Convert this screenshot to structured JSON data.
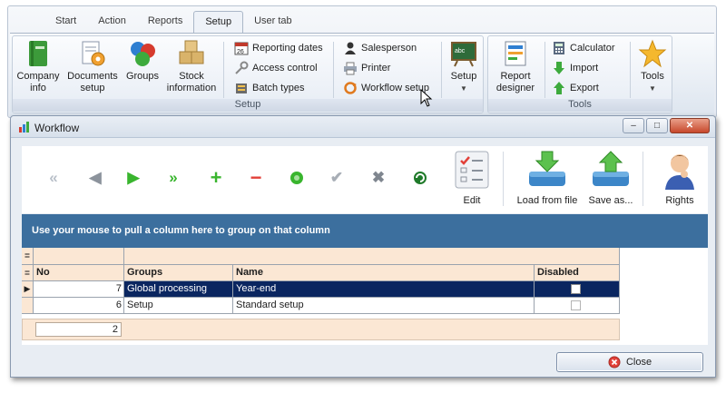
{
  "ribbon": {
    "tabs": [
      "Start",
      "Action",
      "Reports",
      "Setup",
      "User tab"
    ],
    "active_tab": "Setup",
    "setup_group": {
      "label": "Setup",
      "company_info": "Company info",
      "documents_setup": "Documents setup",
      "groups": "Groups",
      "stock_information": "Stock information",
      "reporting_dates": "Reporting dates",
      "access_control": "Access control",
      "batch_types": "Batch types",
      "salesperson": "Salesperson",
      "printer": "Printer",
      "workflow_setup": "Workflow setup",
      "setup_button": "Setup"
    },
    "tools_group": {
      "label": "Tools",
      "report_designer": "Report designer",
      "calculator": "Calculator",
      "import": "Import",
      "export": "Export",
      "tools_button": "Tools"
    }
  },
  "window": {
    "title": "Workflow",
    "toolbar": {
      "edit": "Edit",
      "load_from_file": "Load from file",
      "save_as": "Save as...",
      "rights": "Rights"
    },
    "group_panel_text": "Use your mouse to pull a column here to group on that column",
    "grid": {
      "columns": [
        "No",
        "Groups",
        "Name",
        "Disabled"
      ],
      "rows": [
        {
          "no": "7",
          "group": "Global processing",
          "name": "Year-end",
          "disabled": false,
          "selected": true
        },
        {
          "no": "6",
          "group": "Setup",
          "name": "Standard setup",
          "disabled": false,
          "selected": false
        }
      ],
      "footer_count": "2"
    },
    "close_button": "Close"
  },
  "colors": {
    "selected_row": "#0a2660",
    "group_panel": "#3c6f9e",
    "header_bg": "#fbe7d4",
    "green": "#39b52e",
    "red": "#e2413a"
  }
}
